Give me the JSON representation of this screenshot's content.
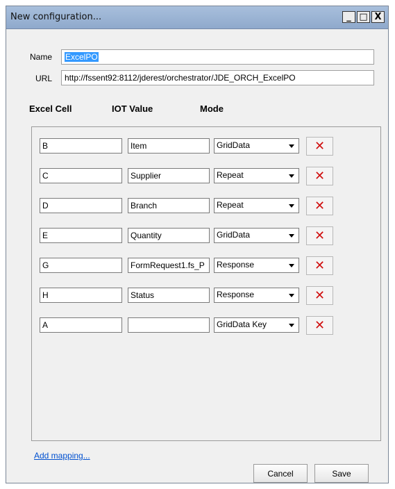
{
  "window": {
    "title": "New configuration...",
    "controls": {
      "minimize": "_",
      "maximize": "□",
      "close": "X"
    }
  },
  "form": {
    "name_label": "Name",
    "name_value": "ExcelPO",
    "url_label": "URL",
    "url_value": "http://fssent92:8112/jderest/orchestrator/JDE_ORCH_ExcelPO"
  },
  "columns": {
    "excel_cell": "Excel Cell",
    "iot_value": "IOT Value",
    "mode": "Mode"
  },
  "mappings": [
    {
      "excel_cell": "B",
      "iot_value": "Item",
      "mode": "GridData"
    },
    {
      "excel_cell": "C",
      "iot_value": "Supplier",
      "mode": "Repeat"
    },
    {
      "excel_cell": "D",
      "iot_value": "Branch",
      "mode": "Repeat"
    },
    {
      "excel_cell": "E",
      "iot_value": "Quantity",
      "mode": "GridData"
    },
    {
      "excel_cell": "G",
      "iot_value": "FormRequest1.fs_P",
      "mode": "Response"
    },
    {
      "excel_cell": "H",
      "iot_value": "Status",
      "mode": "Response"
    },
    {
      "excel_cell": "A",
      "iot_value": "",
      "mode": "GridData Key"
    }
  ],
  "delete_glyph": "✕",
  "delete_icon": "delete-x-icon",
  "add_mapping_label": "Add mapping...",
  "buttons": {
    "cancel": "Cancel",
    "save": "Save"
  },
  "colors": {
    "titlebar": "#a8bfdc",
    "selection": "#3399ff",
    "delete_red": "#d01010",
    "link": "#0050d0"
  }
}
